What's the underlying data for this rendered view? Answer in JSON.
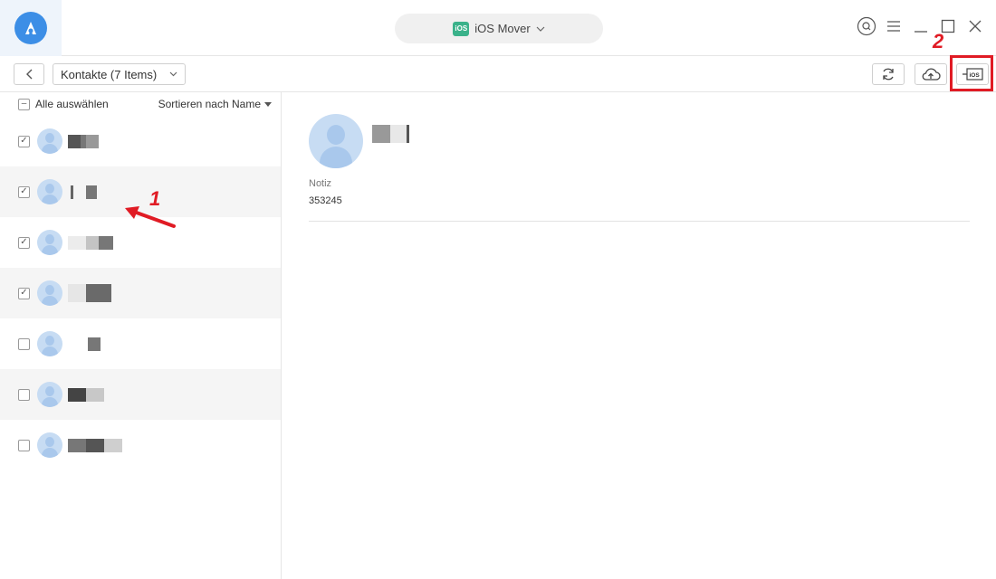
{
  "app": {
    "title": "iOS Mover",
    "badge": "iOS",
    "accent_color": "#3c8ee6"
  },
  "toolbar": {
    "category": "Kontakte (7 Items)",
    "buttons": [
      "refresh-icon",
      "cloud-upload-icon",
      "to-ios-icon"
    ]
  },
  "list": {
    "select_all": "Alle auswählen",
    "sort": "Sortieren nach Name",
    "contacts": [
      {
        "checked": true
      },
      {
        "checked": true
      },
      {
        "checked": true
      },
      {
        "checked": true
      },
      {
        "checked": false
      },
      {
        "checked": false
      },
      {
        "checked": false
      }
    ]
  },
  "detail": {
    "note_label": "Notiz",
    "note_value": "353245"
  },
  "annotations": {
    "one": "1",
    "two": "2",
    "color": "#e01b24"
  }
}
